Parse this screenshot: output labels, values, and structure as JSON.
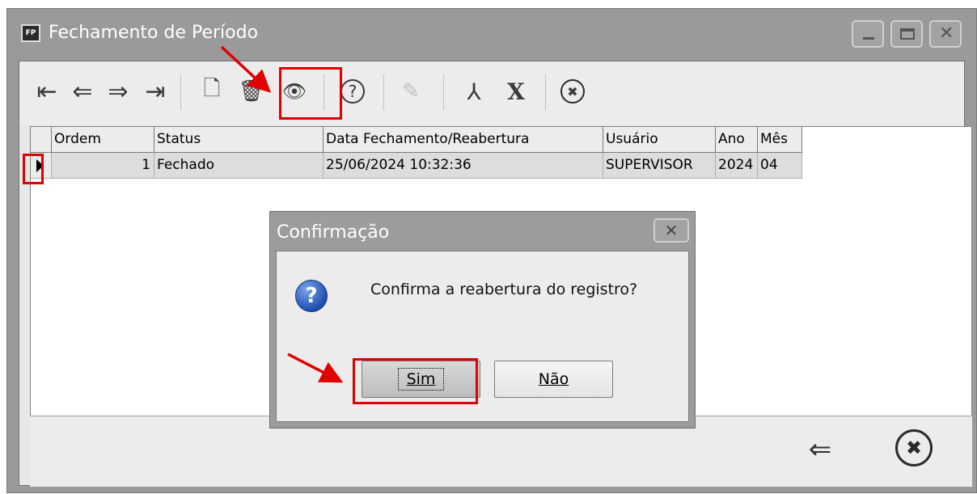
{
  "window": {
    "icon_text": "FP",
    "title": "Fechamento de Período"
  },
  "toolbar": {
    "first": "⇤",
    "prev": "⇐",
    "next": "⇒",
    "last": "⇥",
    "new": "🗋",
    "delete": "🗑",
    "view": "👁",
    "help": "?",
    "edit": "✎",
    "pdf": "⅄",
    "excel": "X",
    "close": "✖"
  },
  "grid": {
    "columns": [
      "Ordem",
      "Status",
      "Data Fechamento/Reabertura",
      "Usuário",
      "Ano",
      "Mês"
    ],
    "rows": [
      {
        "ordem": "1",
        "status": "Fechado",
        "data": "25/06/2024 10:32:36",
        "usuario": "SUPERVISOR",
        "ano": "2024",
        "mes": "04"
      }
    ]
  },
  "footer": {
    "back": "⇐",
    "close": "✖"
  },
  "dialog": {
    "title": "Confirmação",
    "close": "✕",
    "icon": "?",
    "message": "Confirma a reabertura do registro?",
    "yes": "Sim",
    "no": "Não"
  },
  "colors": {
    "highlight": "#e00000",
    "titlebar": "#9a9a9a"
  }
}
